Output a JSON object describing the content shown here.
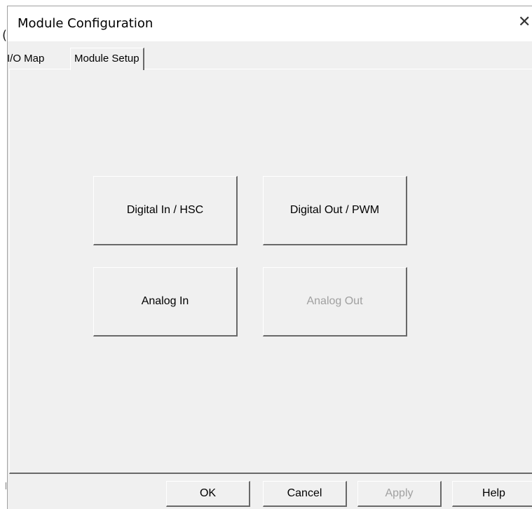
{
  "window": {
    "title": "Module Configuration",
    "close_glyph": "✕",
    "edge_glyph": "("
  },
  "tabs": [
    {
      "label": "I/O Map",
      "selected": false
    },
    {
      "label": "Module Setup",
      "selected": true
    }
  ],
  "module_setup": {
    "buttons": [
      {
        "label": "Digital In / HSC",
        "enabled": true
      },
      {
        "label": "Digital Out / PWM",
        "enabled": true
      },
      {
        "label": "Analog In",
        "enabled": true
      },
      {
        "label": "Analog Out",
        "enabled": false
      }
    ]
  },
  "dialog_buttons": {
    "ok": "OK",
    "cancel": "Cancel",
    "apply": "Apply",
    "help": "Help"
  },
  "icons": {
    "close": "close-icon"
  },
  "colors": {
    "face": "#f0f0f0",
    "shadow": "#696969",
    "highlight": "#ffffff",
    "disabled_text": "#a0a0a0"
  }
}
